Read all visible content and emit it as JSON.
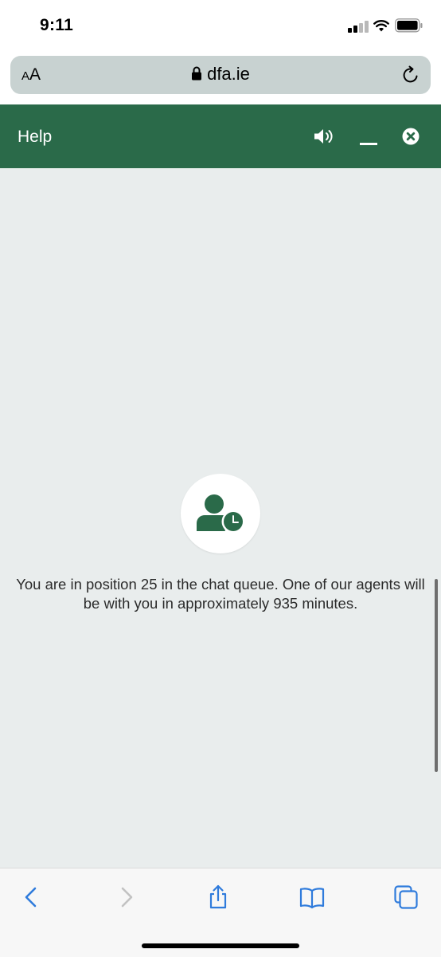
{
  "status_bar": {
    "time": "9:11",
    "icons": [
      "cellular-signal-icon",
      "wifi-icon",
      "battery-icon"
    ]
  },
  "url_bar": {
    "text_size_label_small": "A",
    "text_size_label_large": "A",
    "url": "dfa.ie",
    "icons": [
      "lock-icon",
      "reload-icon"
    ]
  },
  "chat_header": {
    "title": "Help",
    "icons": [
      "volume-icon",
      "minimize-icon",
      "close-icon"
    ],
    "background_color": "#2a6a49"
  },
  "chat_body": {
    "avatar_icon": "user-clock-icon",
    "queue_message": "You are in position 25 in the chat queue. One of our agents will be with you in approximately 935 minutes.",
    "background_color": "#e9eded"
  },
  "toolbar": {
    "buttons": [
      "back-icon",
      "forward-icon",
      "share-icon",
      "bookmarks-icon",
      "tabs-icon"
    ],
    "accent_color": "#2f7bdc"
  }
}
